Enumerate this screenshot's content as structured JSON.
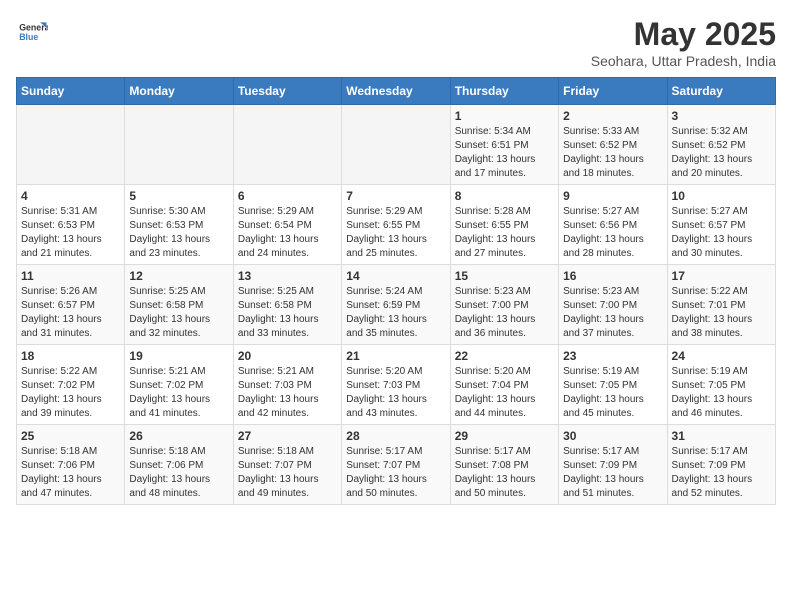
{
  "logo": {
    "general": "General",
    "blue": "Blue"
  },
  "title": "May 2025",
  "subtitle": "Seohara, Uttar Pradesh, India",
  "days_of_week": [
    "Sunday",
    "Monday",
    "Tuesday",
    "Wednesday",
    "Thursday",
    "Friday",
    "Saturday"
  ],
  "weeks": [
    [
      {
        "day": "",
        "info": ""
      },
      {
        "day": "",
        "info": ""
      },
      {
        "day": "",
        "info": ""
      },
      {
        "day": "",
        "info": ""
      },
      {
        "day": "1",
        "info": "Sunrise: 5:34 AM\nSunset: 6:51 PM\nDaylight: 13 hours and 17 minutes."
      },
      {
        "day": "2",
        "info": "Sunrise: 5:33 AM\nSunset: 6:52 PM\nDaylight: 13 hours and 18 minutes."
      },
      {
        "day": "3",
        "info": "Sunrise: 5:32 AM\nSunset: 6:52 PM\nDaylight: 13 hours and 20 minutes."
      }
    ],
    [
      {
        "day": "4",
        "info": "Sunrise: 5:31 AM\nSunset: 6:53 PM\nDaylight: 13 hours and 21 minutes."
      },
      {
        "day": "5",
        "info": "Sunrise: 5:30 AM\nSunset: 6:53 PM\nDaylight: 13 hours and 23 minutes."
      },
      {
        "day": "6",
        "info": "Sunrise: 5:29 AM\nSunset: 6:54 PM\nDaylight: 13 hours and 24 minutes."
      },
      {
        "day": "7",
        "info": "Sunrise: 5:29 AM\nSunset: 6:55 PM\nDaylight: 13 hours and 25 minutes."
      },
      {
        "day": "8",
        "info": "Sunrise: 5:28 AM\nSunset: 6:55 PM\nDaylight: 13 hours and 27 minutes."
      },
      {
        "day": "9",
        "info": "Sunrise: 5:27 AM\nSunset: 6:56 PM\nDaylight: 13 hours and 28 minutes."
      },
      {
        "day": "10",
        "info": "Sunrise: 5:27 AM\nSunset: 6:57 PM\nDaylight: 13 hours and 30 minutes."
      }
    ],
    [
      {
        "day": "11",
        "info": "Sunrise: 5:26 AM\nSunset: 6:57 PM\nDaylight: 13 hours and 31 minutes."
      },
      {
        "day": "12",
        "info": "Sunrise: 5:25 AM\nSunset: 6:58 PM\nDaylight: 13 hours and 32 minutes."
      },
      {
        "day": "13",
        "info": "Sunrise: 5:25 AM\nSunset: 6:58 PM\nDaylight: 13 hours and 33 minutes."
      },
      {
        "day": "14",
        "info": "Sunrise: 5:24 AM\nSunset: 6:59 PM\nDaylight: 13 hours and 35 minutes."
      },
      {
        "day": "15",
        "info": "Sunrise: 5:23 AM\nSunset: 7:00 PM\nDaylight: 13 hours and 36 minutes."
      },
      {
        "day": "16",
        "info": "Sunrise: 5:23 AM\nSunset: 7:00 PM\nDaylight: 13 hours and 37 minutes."
      },
      {
        "day": "17",
        "info": "Sunrise: 5:22 AM\nSunset: 7:01 PM\nDaylight: 13 hours and 38 minutes."
      }
    ],
    [
      {
        "day": "18",
        "info": "Sunrise: 5:22 AM\nSunset: 7:02 PM\nDaylight: 13 hours and 39 minutes."
      },
      {
        "day": "19",
        "info": "Sunrise: 5:21 AM\nSunset: 7:02 PM\nDaylight: 13 hours and 41 minutes."
      },
      {
        "day": "20",
        "info": "Sunrise: 5:21 AM\nSunset: 7:03 PM\nDaylight: 13 hours and 42 minutes."
      },
      {
        "day": "21",
        "info": "Sunrise: 5:20 AM\nSunset: 7:03 PM\nDaylight: 13 hours and 43 minutes."
      },
      {
        "day": "22",
        "info": "Sunrise: 5:20 AM\nSunset: 7:04 PM\nDaylight: 13 hours and 44 minutes."
      },
      {
        "day": "23",
        "info": "Sunrise: 5:19 AM\nSunset: 7:05 PM\nDaylight: 13 hours and 45 minutes."
      },
      {
        "day": "24",
        "info": "Sunrise: 5:19 AM\nSunset: 7:05 PM\nDaylight: 13 hours and 46 minutes."
      }
    ],
    [
      {
        "day": "25",
        "info": "Sunrise: 5:18 AM\nSunset: 7:06 PM\nDaylight: 13 hours and 47 minutes."
      },
      {
        "day": "26",
        "info": "Sunrise: 5:18 AM\nSunset: 7:06 PM\nDaylight: 13 hours and 48 minutes."
      },
      {
        "day": "27",
        "info": "Sunrise: 5:18 AM\nSunset: 7:07 PM\nDaylight: 13 hours and 49 minutes."
      },
      {
        "day": "28",
        "info": "Sunrise: 5:17 AM\nSunset: 7:07 PM\nDaylight: 13 hours and 50 minutes."
      },
      {
        "day": "29",
        "info": "Sunrise: 5:17 AM\nSunset: 7:08 PM\nDaylight: 13 hours and 50 minutes."
      },
      {
        "day": "30",
        "info": "Sunrise: 5:17 AM\nSunset: 7:09 PM\nDaylight: 13 hours and 51 minutes."
      },
      {
        "day": "31",
        "info": "Sunrise: 5:17 AM\nSunset: 7:09 PM\nDaylight: 13 hours and 52 minutes."
      }
    ]
  ]
}
